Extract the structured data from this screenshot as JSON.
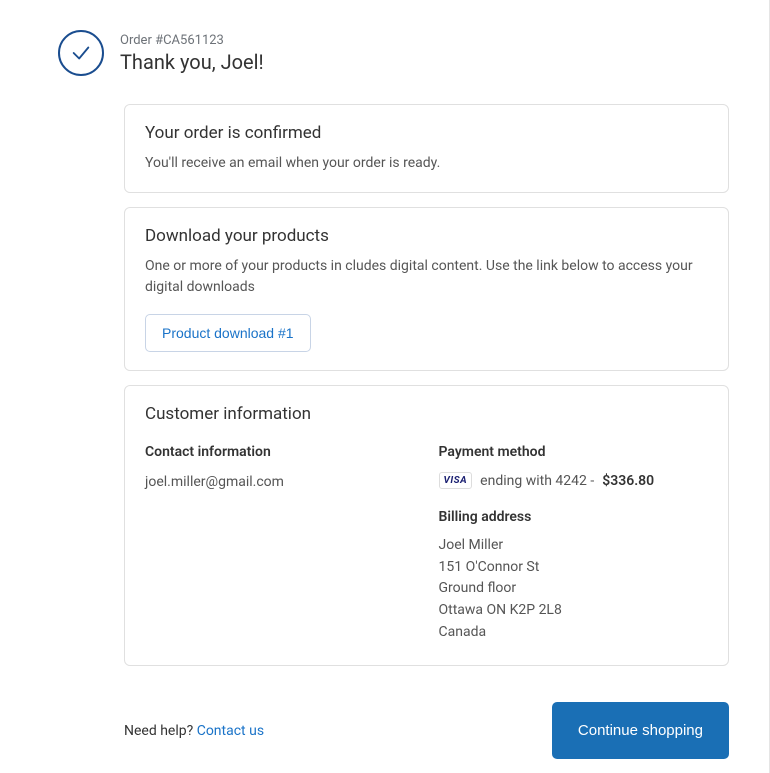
{
  "header": {
    "order_number": "Order #CA561123",
    "thank_you": "Thank you, Joel!"
  },
  "confirm_card": {
    "title": "Your order is confirmed",
    "body": "You'll receive an email when your order is ready."
  },
  "download_card": {
    "title": "Download your products",
    "body": "One or more of your products in cludes digital content. Use the link below to access your digital downloads",
    "button": "Product download #1"
  },
  "customer": {
    "title": "Customer information",
    "contact": {
      "label": "Contact information",
      "email": "joel.miller@gmail.com"
    },
    "payment": {
      "label": "Payment method",
      "card_brand": "VISA",
      "ending_text": "ending with 4242 -",
      "amount": "$336.80"
    },
    "billing": {
      "label": "Billing address",
      "line1": "Joel Miller",
      "line2": "151 O'Connor St",
      "line3": "Ground floor",
      "line4": "Ottawa ON K2P 2L8",
      "line5": "Canada"
    }
  },
  "footer": {
    "help_text": "Need help? ",
    "contact_link": "Contact us",
    "continue_btn": "Continue shopping"
  }
}
